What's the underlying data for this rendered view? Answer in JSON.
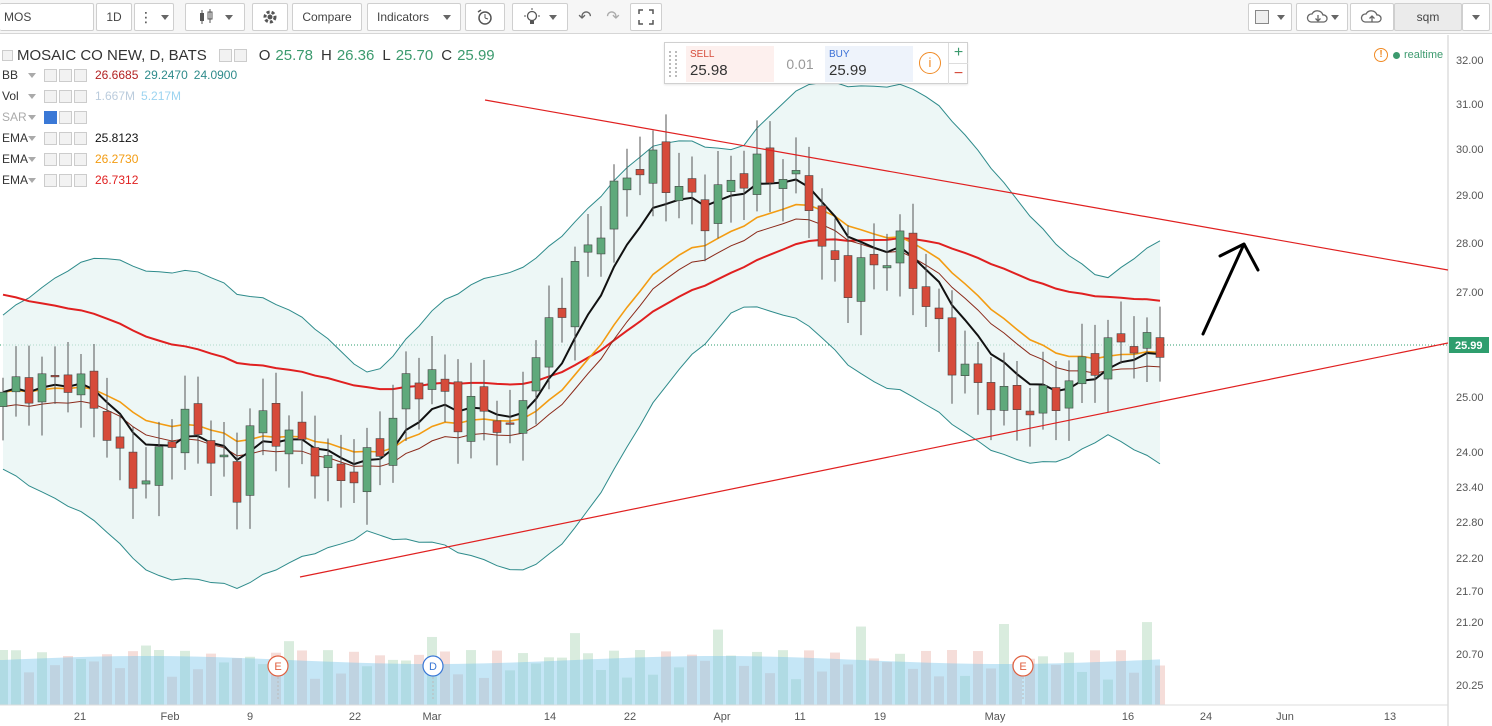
{
  "toolbar": {
    "symbol": "MOS",
    "interval": "1D",
    "compare_label": "Compare",
    "indicators_label": "Indicators",
    "user": "sqm"
  },
  "legend": {
    "title": "MOSAIC CO NEW, D, BATS",
    "ohlc": {
      "o_label": "O",
      "o": "25.78",
      "h_label": "H",
      "h": "26.36",
      "l_label": "L",
      "l": "25.70",
      "c_label": "C",
      "c": "25.99"
    },
    "indicators": [
      {
        "name": "BB",
        "values": [
          "26.6685",
          "29.2470",
          "24.0900"
        ],
        "colors": [
          "#b22222",
          "#2e8b8b",
          "#2e8b8b"
        ]
      },
      {
        "name": "Vol",
        "values": [
          "1.667M",
          "5.217M"
        ],
        "colors": [
          "#bcd",
          "#9cd4f0"
        ]
      },
      {
        "name": "SAR",
        "values": [],
        "colors": []
      },
      {
        "name": "EMA",
        "values": [
          "25.8123"
        ],
        "colors": [
          "#111111"
        ]
      },
      {
        "name": "EMA",
        "values": [
          "26.2730"
        ],
        "colors": [
          "#f39c12"
        ]
      },
      {
        "name": "EMA",
        "values": [
          "26.7312"
        ],
        "colors": [
          "#e02020"
        ]
      }
    ],
    "realtime_label": "realtime"
  },
  "trade": {
    "sell_label": "SELL",
    "sell_price": "25.98",
    "spread": "0.01",
    "buy_label": "BUY",
    "buy_price": "25.99",
    "plus": "+",
    "minus": "−",
    "info": "i"
  },
  "price_axis": {
    "ticks": [
      "32.00",
      "31.00",
      "30.00",
      "29.00",
      "28.00",
      "27.00",
      "25.00",
      "24.00",
      "23.40",
      "22.80",
      "22.20",
      "21.70",
      "21.20",
      "20.70",
      "20.25"
    ],
    "last_price": "25.99",
    "last_price_color": "#2e9e6e"
  },
  "time_axis": {
    "labels": [
      "21",
      "Feb",
      "9",
      "22",
      "Mar",
      "14",
      "22",
      "Apr",
      "11",
      "19",
      "May",
      "16",
      "24",
      "Jun",
      "13"
    ]
  },
  "events": [
    "E",
    "D",
    "E"
  ],
  "colors": {
    "up": "#5fa97b",
    "down": "#d64b3a",
    "bb_line": "#2e8b8b",
    "bb_fill": "#e6f4f2",
    "trend": "#e02020"
  },
  "chart_data": {
    "type": "candlestick",
    "title": "MOSAIC CO NEW, D, BATS",
    "ylim": [
      20.25,
      32.0
    ],
    "ohlc_last": {
      "open": 25.78,
      "high": 26.36,
      "low": 25.7,
      "close": 25.99
    },
    "series": [
      {
        "name": "BB",
        "values": [
          26.6685,
          29.247,
          24.09
        ]
      },
      {
        "name": "EMA",
        "values": [
          25.8123
        ]
      },
      {
        "name": "EMA",
        "values": [
          26.273
        ]
      },
      {
        "name": "EMA",
        "values": [
          26.7312
        ]
      }
    ],
    "volume": {
      "name": "Vol",
      "values": [
        1.667,
        5.217
      ],
      "unit": "M"
    }
  }
}
